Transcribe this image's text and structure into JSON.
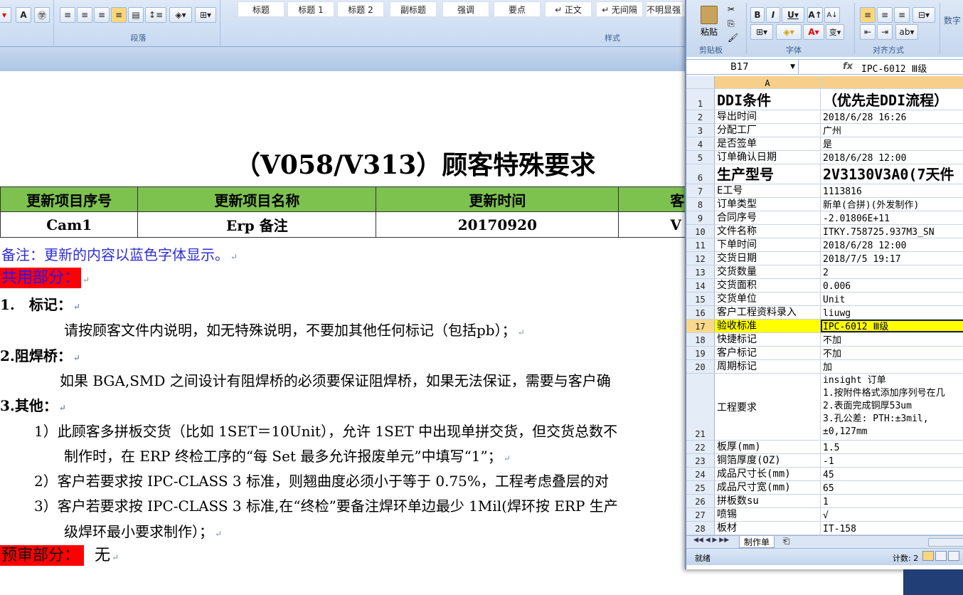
{
  "word": {
    "ribbon": {
      "paragraph_label": "段落",
      "styles_label": "样式",
      "styles": [
        "标题",
        "标题 1",
        "标题 2",
        "副标题",
        "强调",
        "要点",
        "↵ 正文",
        "↵ 无间隔",
        "不明显强"
      ]
    },
    "title": "（V058/V313）顾客特殊要求",
    "table": {
      "headers": [
        "更新项目序号",
        "更新项目名称",
        "更新时间",
        "客"
      ],
      "row": [
        "Cam1",
        "Erp 备注",
        "20170920",
        "V"
      ]
    },
    "note": "备注：更新的内容以蓝色字体显示。",
    "common_heading": "共用部分：",
    "s1_heading": "1.　标记：",
    "s1_body": "请按顾客文件内说明，如无特殊说明，不要加其他任何标记（包括pb）；",
    "s2_heading": "2.阻焊桥：",
    "s2_body": "如果 BGA,SMD 之间设计有阻焊桥的必须要保证阻焊桥，如果无法保证，需要与客户确",
    "s3_heading": "3.其他：",
    "s3_item1": "1）此顾客多拼板交货（比如 1SET＝10Unit），允许 1SET 中出现单拼交货，但交货总数不",
    "s3_item1b": "制作时，在 ERP 终检工序的“每 Set 最多允许报废单元”中填写“1”；",
    "s3_item2": "2）客户若要求按 IPC-CLASS 3 标准，则翘曲度必须小于等于 0.75%，工程考虑叠层的对",
    "s3_item3": "3）客户若要求按 IPC-CLASS 3 标准,在“终检”要备注焊环单边最少 1Mil(焊环按 ERP 生产",
    "s3_item3b": "级焊环最小要求制作）；",
    "prereview_heading": "预审部分：",
    "prereview_value": "无"
  },
  "excel": {
    "ribbon": {
      "paste": "粘贴",
      "clipboard": "剪贴板",
      "font": "字体",
      "align": "对齐方式",
      "number": "数字"
    },
    "namebox": "B17",
    "fx": "fx",
    "formula": "IPC-6012 Ⅲ级",
    "col_header": "A",
    "rows": [
      {
        "n": "1",
        "a": "DDI条件",
        "b": "（优先走DDI流程）"
      },
      {
        "n": "2",
        "a": "导出时间",
        "b": "2018/6/28 16:26"
      },
      {
        "n": "3",
        "a": "分配工厂",
        "b": "广州"
      },
      {
        "n": "4",
        "a": "是否签单",
        "b": "是"
      },
      {
        "n": "5",
        "a": "订单确认日期",
        "b": "2018/6/28 12:00"
      },
      {
        "n": "6",
        "a": "生产型号",
        "b": "2V3130V3A0(7天件"
      },
      {
        "n": "7",
        "a": "E工号",
        "b": "1113816"
      },
      {
        "n": "8",
        "a": "订单类型",
        "b": "新单(合拼)(外发制作)"
      },
      {
        "n": "9",
        "a": "合同序号",
        "b": "-2.01806E+11"
      },
      {
        "n": "10",
        "a": "文件名称",
        "b": "ITKY.758725.937M3_SN"
      },
      {
        "n": "11",
        "a": "下单时间",
        "b": "2018/6/28 12:00"
      },
      {
        "n": "12",
        "a": "交货日期",
        "b": "2018/7/5 19:17"
      },
      {
        "n": "13",
        "a": "交货数量",
        "b": "2"
      },
      {
        "n": "14",
        "a": "交货面积",
        "b": "0.006"
      },
      {
        "n": "15",
        "a": "交货单位",
        "b": "Unit"
      },
      {
        "n": "16",
        "a": "客户工程资料录入",
        "b": "liuwg"
      },
      {
        "n": "17",
        "a": "验收标准",
        "b": "IPC-6012 Ⅲ级"
      },
      {
        "n": "18",
        "a": "快捷标记",
        "b": "不加"
      },
      {
        "n": "19",
        "a": "客户标记",
        "b": "不加"
      },
      {
        "n": "20",
        "a": "周期标记",
        "b": "加"
      },
      {
        "n": "21",
        "a": "工程要求",
        "b": ""
      },
      {
        "n": "22",
        "a": "板厚(mm)",
        "b": "1.5"
      },
      {
        "n": "23",
        "a": "铜箔厚度(OZ)",
        "b": "-1"
      },
      {
        "n": "24",
        "a": "成品尺寸长(mm)",
        "b": "45"
      },
      {
        "n": "25",
        "a": "成品尺寸宽(mm)",
        "b": "65"
      },
      {
        "n": "26",
        "a": "拼板数su",
        "b": "1"
      },
      {
        "n": "27",
        "a": "喷锡",
        "b": "√"
      },
      {
        "n": "28",
        "a": "板材",
        "b": "IT-158"
      }
    ],
    "row21_lines": [
      "insight 订单",
      "1.按附件格式添加序列号在几",
      "2.表面完成铜厚53um",
      "3.孔公差: PTH:±3mil,",
      "±0,127mm"
    ],
    "sheet_tab": "制作单",
    "status_ready": "就绪",
    "status_count": "计数: 2"
  }
}
